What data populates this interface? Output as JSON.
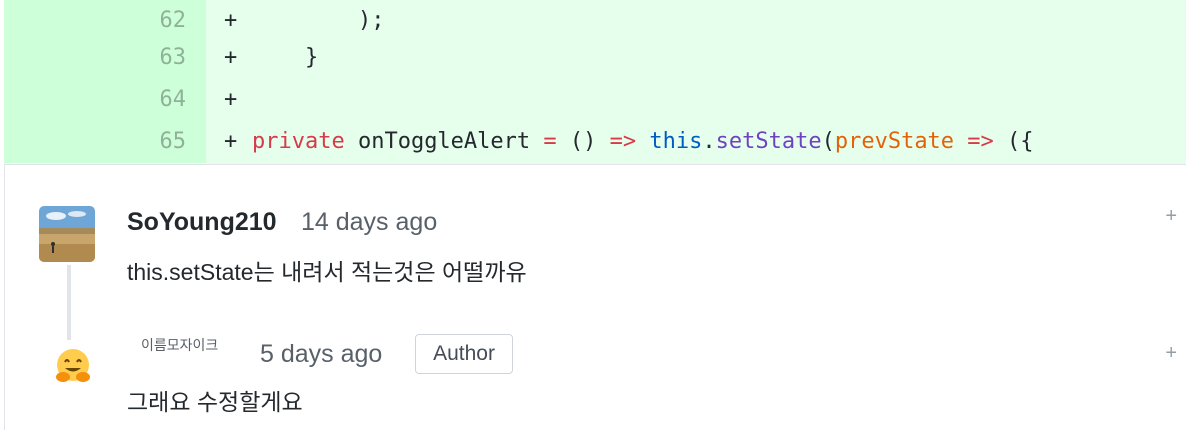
{
  "diff_lines": [
    {
      "num": "62",
      "marker": "+",
      "code": "        );"
    },
    {
      "num": "63",
      "marker": "+",
      "code": "    }"
    },
    {
      "num": "64",
      "marker": "+",
      "code": ""
    },
    {
      "num": "65",
      "marker": "+",
      "code": ""
    }
  ],
  "line65": {
    "private": "private",
    "name": " onToggleAlert ",
    "eq": "=",
    "parens": " () ",
    "arrow": "=>",
    "sp": " ",
    "this": "this",
    "dot": ".",
    "setState": "setState",
    "open": "(",
    "prevState": "prevState",
    "arrow2": " => ",
    "tail": "({"
  },
  "comments": [
    {
      "author": "SoYoung210",
      "time": "14 days ago",
      "body": "this.setState는 내려서 적는것은 어떨까유",
      "add_label": "+"
    },
    {
      "author": "이름모자이크",
      "time": "5 days ago",
      "badge": "Author",
      "body": "그래요 수정할게요",
      "add_label": "+"
    }
  ],
  "icons": {
    "avatar1": "landscape-avatar-icon",
    "avatar2": "hugging-face-emoji-icon"
  }
}
